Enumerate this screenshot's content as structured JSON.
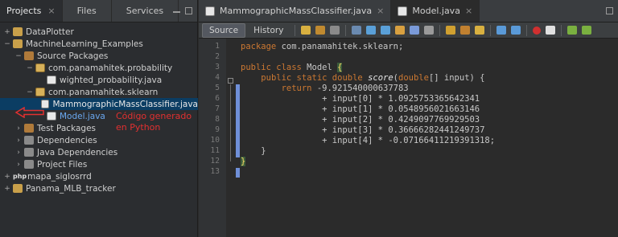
{
  "left_panel": {
    "tabs": [
      {
        "label": "Projects",
        "active": true
      },
      {
        "label": "Files",
        "active": false
      },
      {
        "label": "Services",
        "active": false
      }
    ],
    "tree": [
      {
        "label": "DataPlotter",
        "icon": "project-icon",
        "level": 0,
        "toggle": "+"
      },
      {
        "label": "MachineLearning_Examples",
        "icon": "project-icon",
        "level": 0,
        "toggle": "−"
      },
      {
        "label": "Source Packages",
        "icon": "source-packages-icon",
        "level": 1,
        "toggle": "−"
      },
      {
        "label": "com.panamahitek.probability",
        "icon": "package-icon",
        "level": 2,
        "toggle": "−"
      },
      {
        "label": "wighted_probability.java",
        "icon": "java-file-icon",
        "level": 3,
        "toggle": ""
      },
      {
        "label": "com.panamahitek.sklearn",
        "icon": "package-icon",
        "level": 2,
        "toggle": "−"
      },
      {
        "label": "MammographicMassClassifier.java",
        "icon": "java-file-icon",
        "level": 3,
        "toggle": "",
        "selected": true
      },
      {
        "label": "Model.java",
        "icon": "java-file-icon",
        "level": 3,
        "toggle": "",
        "highlight": true
      },
      {
        "label": "Test Packages",
        "icon": "test-packages-icon",
        "level": 1,
        "toggle": "›"
      },
      {
        "label": "Dependencies",
        "icon": "library-icon",
        "level": 1,
        "toggle": "›"
      },
      {
        "label": "Java Dependencies",
        "icon": "library-icon",
        "level": 1,
        "toggle": "›"
      },
      {
        "label": "Project Files",
        "icon": "folder-icon",
        "level": 1,
        "toggle": "›"
      },
      {
        "label": "mapa_siglosrrd",
        "icon": "php-icon",
        "level": 0,
        "toggle": "+"
      },
      {
        "label": "Panama_MLB_tracker",
        "icon": "project-icon",
        "level": 0,
        "toggle": "+"
      }
    ],
    "annotation": "Código generado en Python",
    "annotation_color": "#e23030"
  },
  "editor": {
    "file_tabs": [
      {
        "label": "MammographicMassClassifier.java",
        "active": false
      },
      {
        "label": "Model.java",
        "active": true
      }
    ],
    "toolbar": {
      "source_label": "Source",
      "history_label": "History"
    },
    "line_numbers": [
      "1",
      "2",
      "3",
      "4",
      "5",
      "6",
      "7",
      "8",
      "9",
      "10",
      "11",
      "12",
      "13"
    ],
    "lines": [
      "package com.panamahitek.sklearn;",
      "",
      "public class Model {",
      "    public static double score(double[] input) {",
      "        return -9.921540000637783",
      "                + input[0] * 1.0925753365642341",
      "                + input[1] * 0.0548956021663146",
      "                + input[2] * 0.4249097769929503",
      "                + input[3] * 0.36666282441249737",
      "                + input[4] * -0.07166411219391318;",
      "    }",
      "}",
      ""
    ],
    "accent_color": "#6f8fd8"
  }
}
